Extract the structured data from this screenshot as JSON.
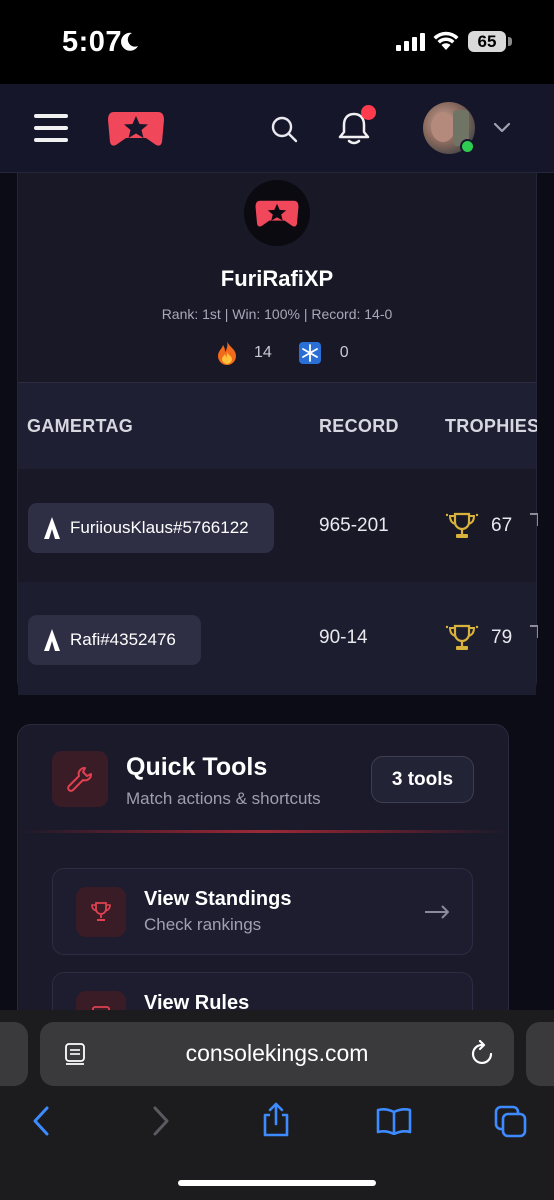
{
  "status_bar": {
    "time": "5:07",
    "battery": "65",
    "icons": [
      "moon-icon",
      "signal-icon",
      "wifi-icon",
      "battery-icon"
    ]
  },
  "header": {
    "icons": [
      "menu-icon",
      "logo-icon",
      "search-icon",
      "bell-icon",
      "chevron-down-icon"
    ],
    "has_notification": true,
    "user_online": true
  },
  "profile": {
    "name": "FuriRafiXP",
    "stats": "Rank: 1st | Win: 100% | Record: 14-0",
    "hot_streak": "14",
    "cold_streak": "0"
  },
  "table": {
    "headers": [
      "GAMERTAG",
      "RECORD",
      "TROPHIES"
    ],
    "rows": [
      {
        "gamertag": "FuriiousKlaus#5766122",
        "record": "965-201",
        "trophies": "67"
      },
      {
        "gamertag": "Rafi#4352476",
        "record": "90-14",
        "trophies": "79"
      }
    ]
  },
  "quick_tools": {
    "title": "Quick Tools",
    "subtitle": "Match actions & shortcuts",
    "badge": "3 tools",
    "items": [
      {
        "title": "View Standings",
        "subtitle": "Check rankings",
        "icon": "trophy-icon"
      },
      {
        "title": "View Rules",
        "subtitle": "",
        "icon": "rules-icon"
      }
    ]
  },
  "browser": {
    "url": "consolekings.com",
    "icons": [
      "reader-icon",
      "reload-icon",
      "back-icon",
      "forward-icon",
      "share-icon",
      "bookmarks-icon",
      "tabs-icon"
    ]
  },
  "colors": {
    "accent_red": "#ff3b4e",
    "online_green": "#2ecc52",
    "trophy_gold": "#d8b23a",
    "background": "#0c0c16"
  }
}
